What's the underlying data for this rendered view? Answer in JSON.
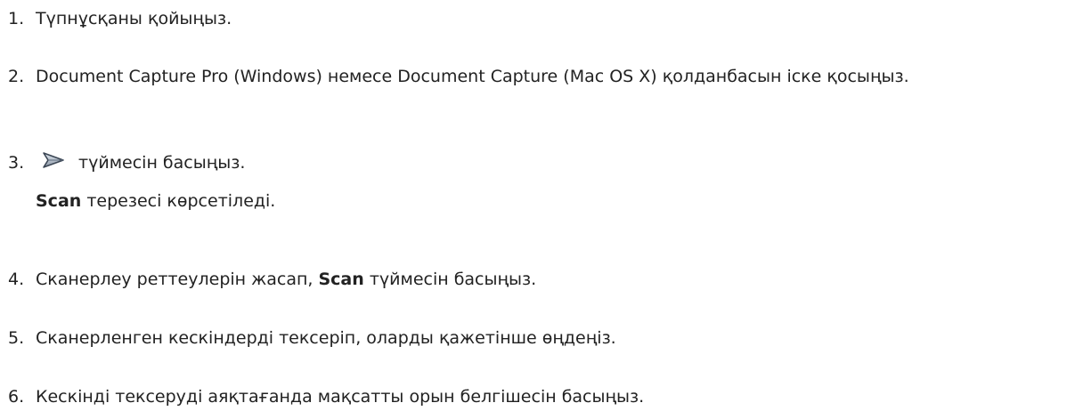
{
  "steps": [
    {
      "number": "1.",
      "text": "Түпнұсқаны қойыңыз."
    },
    {
      "number": "2.",
      "text": "Document Capture Pro (Windows) немесе Document Capture (Mac OS X) қолданбасын іске қосыңыз."
    },
    {
      "number": "3.",
      "icon": "scan-arrow-icon",
      "text_after": " түймесін басыңыз.",
      "sub_bold": "Scan",
      "sub_text": " терезесі көрсетіледі."
    },
    {
      "number": "4.",
      "text_before": "Сканерлеу реттеулерін жасап, ",
      "bold": "Scan",
      "text_after": " түймесін басыңыз."
    },
    {
      "number": "5.",
      "text": "Сканерленген кескіндерді тексеріп, оларды қажетінше өңдеңіз."
    },
    {
      "number": "6.",
      "text": "Кескінді тексеруді аяқтағанда мақсатты орын белгішесін басыңыз."
    }
  ]
}
